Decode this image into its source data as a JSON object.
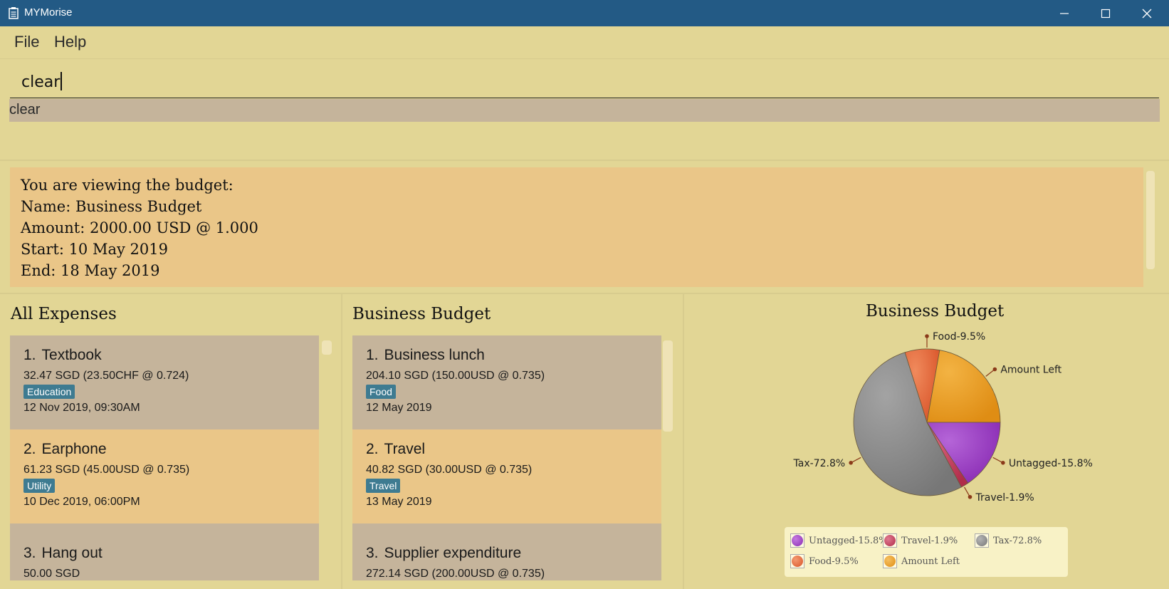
{
  "window": {
    "title": "MYMorise"
  },
  "menu": {
    "file": "File",
    "help": "Help"
  },
  "command": {
    "input_value": "clear",
    "result": "clear"
  },
  "budget_info": {
    "heading": "You are viewing the budget:",
    "name": "Name: Business Budget",
    "amount": "Amount: 2000.00 USD @ 1.000",
    "start": "Start: 10 May 2019",
    "end": "End: 18 May 2019"
  },
  "all_expenses": {
    "title": "All Expenses",
    "items": [
      {
        "index": "1.",
        "name": "Textbook",
        "amount": "32.47 SGD (23.50CHF @ 0.724)",
        "tag": "Education",
        "date": "12 Nov 2019, 09:30AM"
      },
      {
        "index": "2.",
        "name": "Earphone",
        "amount": "61.23 SGD (45.00USD @ 0.735)",
        "tag": "Utility",
        "date": "10 Dec 2019, 06:00PM"
      },
      {
        "index": "3.",
        "name": "Hang out",
        "amount": "50.00 SGD"
      }
    ]
  },
  "budget_expenses": {
    "title": "Business Budget",
    "items": [
      {
        "index": "1.",
        "name": "Business lunch",
        "amount": "204.10 SGD (150.00USD @ 0.735)",
        "tag": "Food",
        "date": "12 May 2019"
      },
      {
        "index": "2.",
        "name": "Travel",
        "amount": "40.82 SGD (30.00USD @ 0.735)",
        "tag": "Travel",
        "date": "13 May 2019"
      },
      {
        "index": "3.",
        "name": "Supplier expenditure",
        "amount": "272.14 SGD (200.00USD @ 0.735)"
      }
    ]
  },
  "chart_data": {
    "type": "pie",
    "title": "Business Budget",
    "slices": [
      {
        "label": "Food-9.5%",
        "value": 9.5,
        "color": "#ea6c3c"
      },
      {
        "label": "Amount Left",
        "value": 0,
        "color": "#e9a02a"
      },
      {
        "label": "Untagged-15.8%",
        "value": 15.8,
        "color": "#a040c8"
      },
      {
        "label": "Travel-1.9%",
        "value": 1.9,
        "color": "#c8405e"
      },
      {
        "label": "Tax-72.8%",
        "value": 72.8,
        "color": "#8c8c8c"
      }
    ],
    "legend": [
      {
        "label": "Untagged-15.8%",
        "color": "#a040c8"
      },
      {
        "label": "Travel-1.9%",
        "color": "#c8405e"
      },
      {
        "label": "Tax-72.8%",
        "color": "#8c8c8c"
      },
      {
        "label": "Food-9.5%",
        "color": "#ea6c3c"
      },
      {
        "label": "Amount Left",
        "color": "#e9a02a"
      }
    ],
    "legend_position": "bottom"
  }
}
